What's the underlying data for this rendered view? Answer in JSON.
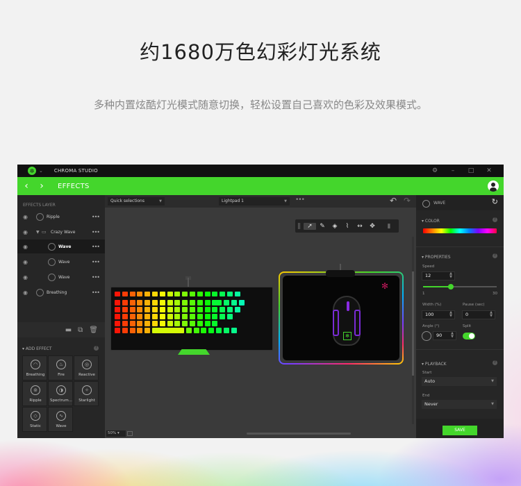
{
  "hero": {
    "title": "约1680万色幻彩灯光系统",
    "subtitle": "多种内置炫酷灯光模式随意切换，轻松设置自己喜欢的色彩及效果模式。"
  },
  "app": {
    "name": "CHROMA STUDIO",
    "section_title": "EFFECTS",
    "accent_color": "#44d62c"
  },
  "layers": {
    "header": "EFFECTS LAYER",
    "items": [
      {
        "label": "Ripple"
      },
      {
        "label": "Crazy Wave"
      },
      {
        "label": "Wave"
      },
      {
        "label": "Wave"
      },
      {
        "label": "Wave"
      },
      {
        "label": "Breathing"
      }
    ]
  },
  "add_effect": {
    "header": "ADD EFFECT",
    "effects": [
      "Breathing",
      "Fire",
      "Reactive",
      "Ripple",
      "Spectrum...",
      "Starlight",
      "Static",
      "Wave"
    ]
  },
  "canvas": {
    "quick_selections": "Quick selections",
    "device_profile": "Lightpad 1",
    "zoom": "50%"
  },
  "right": {
    "effect_name": "WAVE",
    "color_header": "COLOR",
    "properties_header": "PROPERTIES",
    "speed_label": "Speed",
    "speed_value": "12",
    "speed_min": "1",
    "speed_max": "30",
    "speed_fraction": 0.38,
    "width_label": "Width (%)",
    "width_value": "100",
    "pause_label": "Pause (sec)",
    "pause_value": "0",
    "angle_label": "Angle (°)",
    "angle_value": "90",
    "split_label": "Split",
    "split_on": true,
    "playback_header": "PLAYBACK",
    "start_label": "Start",
    "start_value": "Auto",
    "end_label": "End",
    "end_value": "Never",
    "save_label": "SAVE"
  },
  "icons": {
    "eye": "eye-icon",
    "more": "more-icon",
    "refresh": "refresh-icon",
    "undo": "undo-icon",
    "redo": "redo-icon"
  }
}
